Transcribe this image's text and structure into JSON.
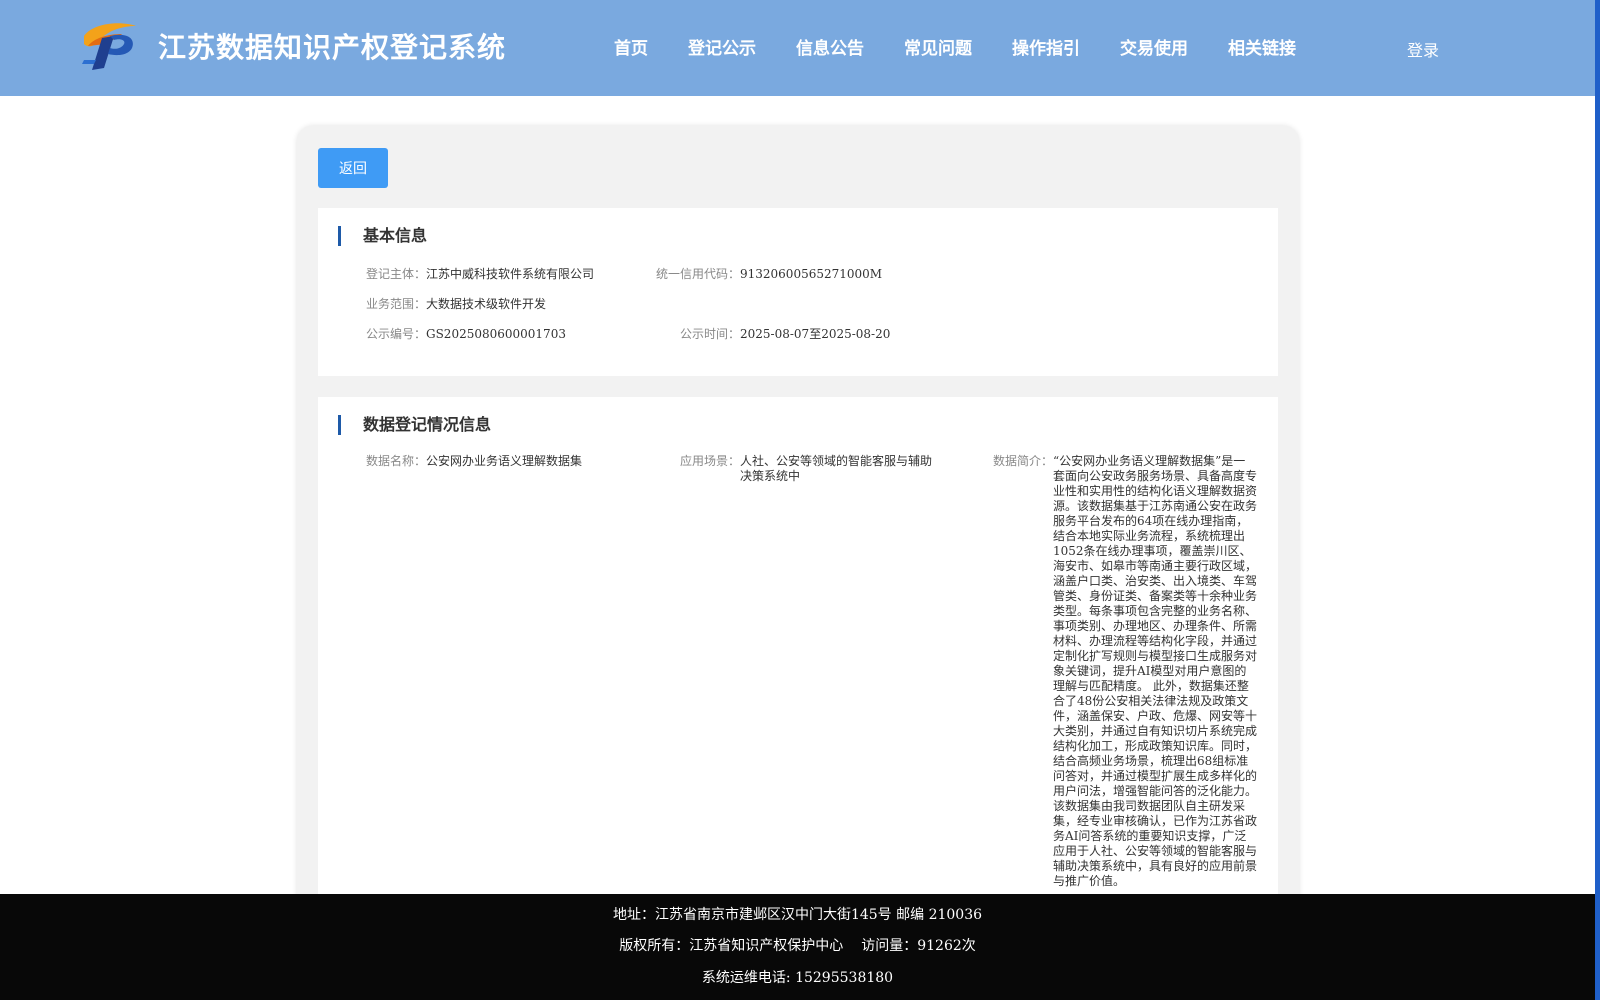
{
  "header": {
    "title": "江苏数据知识产权登记系统",
    "nav": [
      "首页",
      "登记公示",
      "信息公告",
      "常见问题",
      "操作指引",
      "交易使用",
      "相关链接"
    ],
    "login": "登录"
  },
  "actions": {
    "back_label": "返回"
  },
  "basic_info": {
    "title": "基本信息",
    "subject_label": "登记主体：",
    "subject": "江苏中威科技软件系统有限公司",
    "credit_code_label": "统一信用代码：",
    "credit_code": "91320600565271000M",
    "scope_label": "业务范围：",
    "scope": "大数据技术级软件开发",
    "notice_no_label": "公示编号：",
    "notice_no": "GS2025080600001703",
    "notice_time_label": "公示时间：",
    "notice_time": "2025-08-07至2025-08-20"
  },
  "registration_info": {
    "title": "数据登记情况信息",
    "data_name_label": "数据名称：",
    "data_name": "公安网办业务语义理解数据集",
    "scenario_label": "应用场景：",
    "scenario": "人社、公安等领域的智能客服与辅助决策系统中",
    "intro_label": "数据简介：",
    "intro": "“公安网办业务语义理解数据集”是一套面向公安政务服务场景、具备高度专业性和实用性的结构化语义理解数据资源。该数据集基于江苏南通公安在政务服务平台发布的64项在线办理指南，结合本地实际业务流程，系统梳理出1052条在线办理事项，覆盖崇川区、海安市、如皋市等南通主要行政区域，涵盖户口类、治安类、出入境类、车驾管类、身份证类、备案类等十余种业务类型。每条事项包含完整的业务名称、事项类别、办理地区、办理条件、所需材料、办理流程等结构化字段，并通过定制化扩写规则与模型接口生成服务对象关键词，提升AI模型对用户意图的理解与匹配精度。 此外，数据集还整合了48份公安相关法律法规及政策文件，涵盖保安、户政、危爆、网安等十大类别，并通过自有知识切片系统完成结构化加工，形成政策知识库。同时，结合高频业务场景，梳理出68组标准问答对，并通过模型扩展生成多样化的用户问法，增强智能问答的泛化能力。该数据集由我司数据团队自主研发采集，经专业审核确认，已作为江苏省政务AI问答系统的重要知识支撑，广泛应用于人社、公安等领域的智能客服与辅助决策系统中，具有良好的应用前景与推广价值。"
  },
  "footer": {
    "address": "地址：江苏省南京市建邺区汉中门大街145号 邮编 210036",
    "copyright": "版权所有：江苏省知识产权保护中心",
    "visits": "访问量：91262次",
    "phone": "系统运维电话: 15295538180"
  }
}
